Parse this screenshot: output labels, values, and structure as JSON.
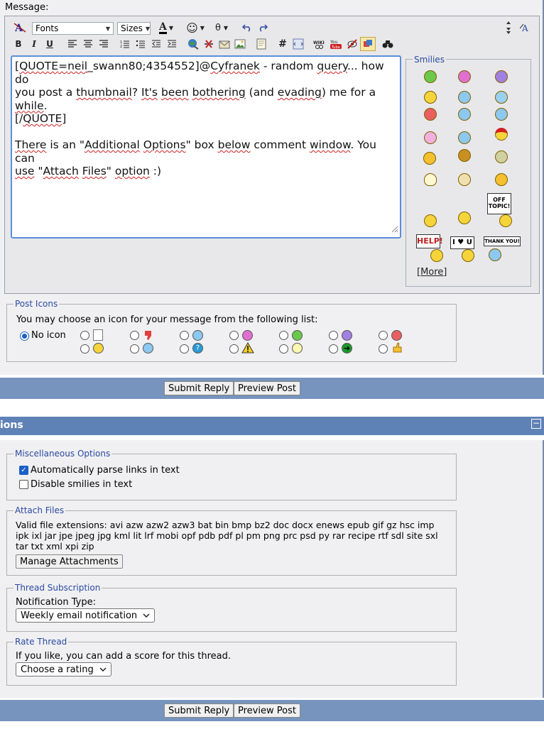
{
  "message_label": "Message:",
  "toolbar": {
    "font_select": "Fonts",
    "size_select": "Sizes",
    "bold": "B",
    "italic": "I",
    "underline": "U",
    "hash": "#",
    "color_label": "A",
    "smilies_label": "☺",
    "theta_label": "θ"
  },
  "editor": {
    "text_line1_parts": [
      "[",
      "QUOTE",
      "=",
      "neil",
      "_swann80;4354552]@",
      "Cyfranek",
      " - random ",
      "query",
      "... how do"
    ],
    "text_line2_parts": [
      "you post a ",
      "thumbnail",
      "?  ",
      "It's",
      " ",
      "been",
      " ",
      "bothering",
      " (and ",
      "evading",
      ") me for a ",
      "while",
      "."
    ],
    "text_line3_parts": [
      "[/",
      "QUOTE",
      "]"
    ],
    "text_line5_parts": [
      "There",
      " is an \"",
      "Additional",
      " ",
      "Options",
      "\" box ",
      "below",
      " comment ",
      "window",
      ". You can"
    ],
    "text_line6_parts": [
      "use",
      " \"",
      "Attach",
      " ",
      "Files",
      "\" ",
      "option",
      " :)"
    ]
  },
  "smilies": {
    "title": "Smilies",
    "more": "[More]",
    "sign_off_topic": "OFF TOPIC!",
    "sign_help": "HELP!",
    "sign_i_love_u": "I ♥ U",
    "sign_thank_you": "THANK YOU!"
  },
  "post_icons": {
    "legend": "Post Icons",
    "description": "You may choose an icon for your message from the following list:",
    "no_icon_label": "No icon"
  },
  "buttons": {
    "submit_reply": "Submit Reply",
    "preview_post": "Preview Post"
  },
  "options_header": {
    "title": "ions",
    "collapse": "−"
  },
  "misc_options": {
    "legend": "Miscellaneous Options",
    "parse_links": "Automatically parse links in text",
    "parse_links_checked": true,
    "disable_smilies": "Disable smilies in text",
    "disable_smilies_checked": false
  },
  "attach_files": {
    "legend": "Attach Files",
    "extensions_line1": "Valid file extensions: avi azw azw2 azw3 bat bin bmp bz2 doc docx enews epub gif gz hsc imp",
    "extensions_line2": "ipk ixl jar jpe jpeg jpg kml lit lrf mobi opf pdb pdf pl pm png prc psd py rar recipe rtf sdl site sxl",
    "extensions_line3": "tar txt xml xpi zip",
    "manage_button": "Manage Attachments"
  },
  "thread_subscription": {
    "legend": "Thread Subscription",
    "label": "Notification Type:",
    "selected": "Weekly email notification"
  },
  "rate_thread": {
    "legend": "Rate Thread",
    "description": "If you like, you can add a score for this thread.",
    "selected": "Choose a rating"
  }
}
